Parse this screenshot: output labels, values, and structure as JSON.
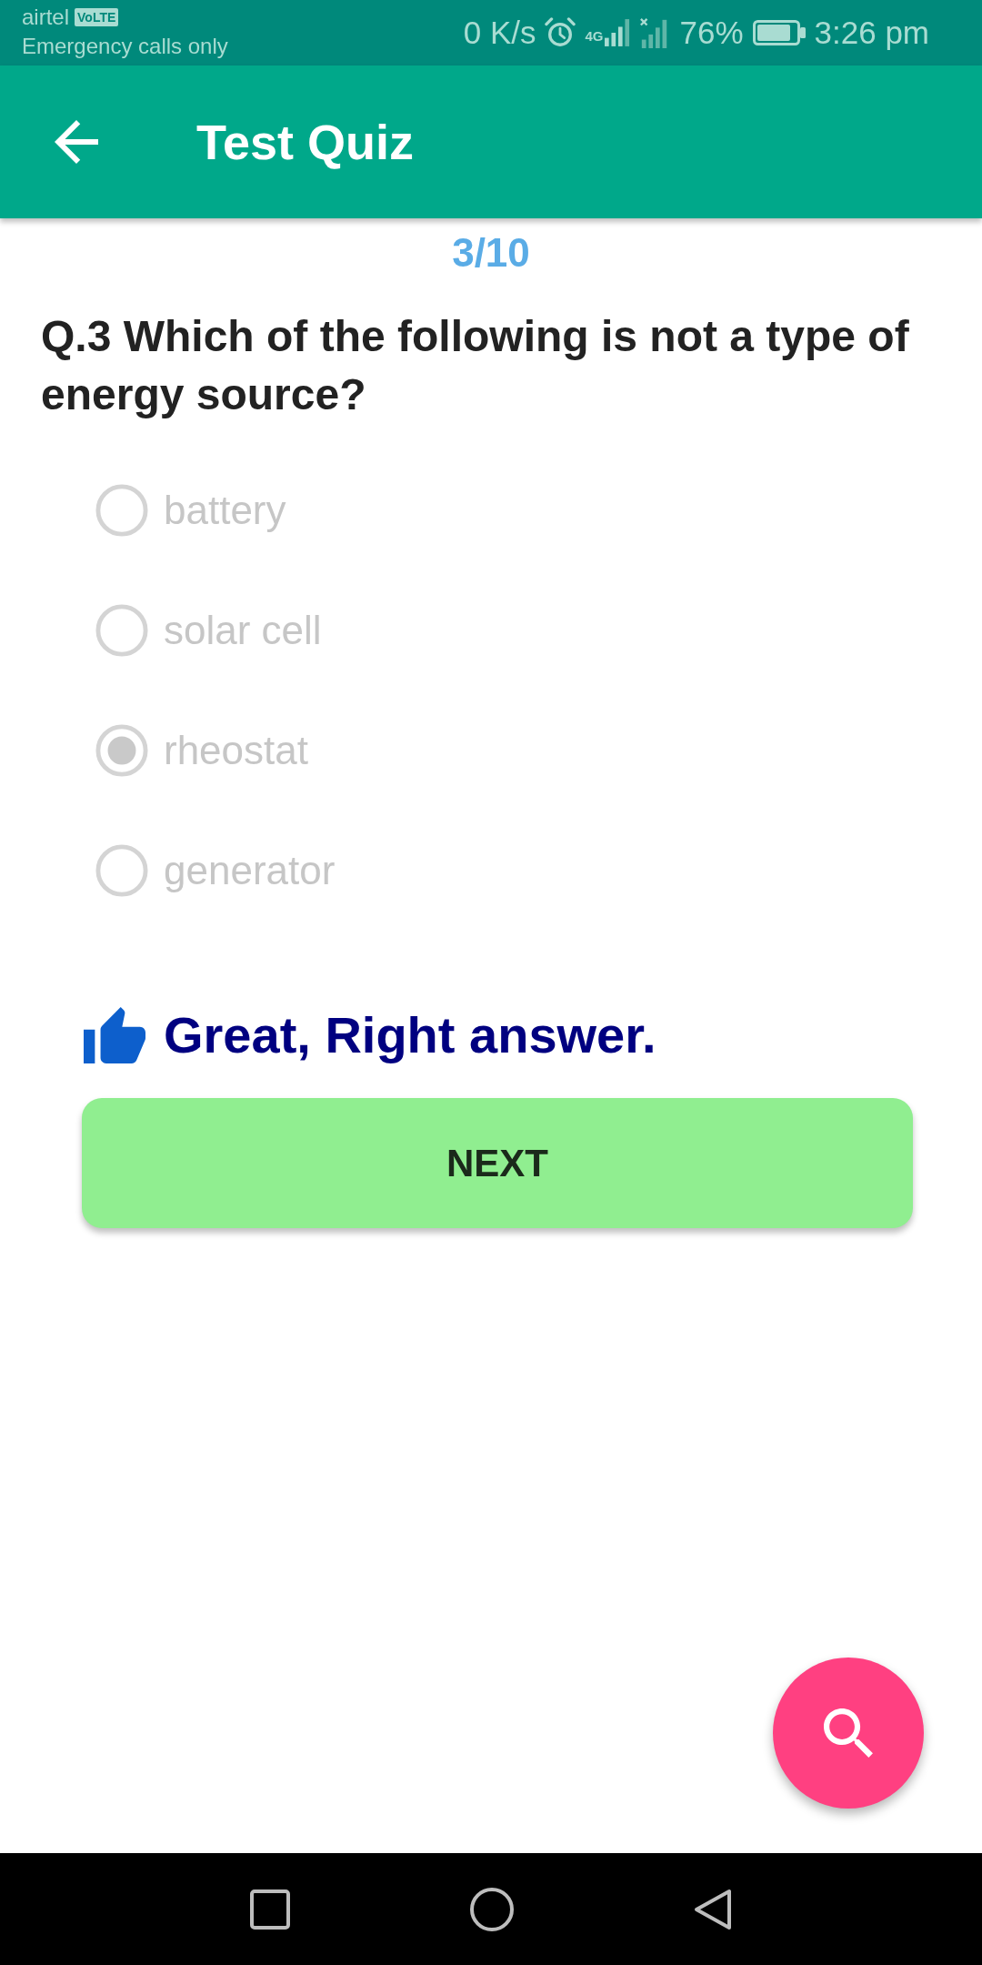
{
  "status_bar": {
    "carrier": "airtel",
    "carrier_badge": "VoLTE",
    "network_note": "Emergency calls only",
    "data_speed": "0 K/s",
    "network_type": "4G",
    "battery": "76%",
    "time": "3:26 pm"
  },
  "app_bar": {
    "title": "Test Quiz"
  },
  "quiz": {
    "progress": "3/10",
    "question": "Q.3 Which of the following is not a type of energy source?",
    "options": [
      {
        "label": "battery",
        "selected": false,
        "disabled": true
      },
      {
        "label": "solar cell",
        "selected": false,
        "disabled": true
      },
      {
        "label": "rheostat",
        "selected": true,
        "disabled": true
      },
      {
        "label": "generator",
        "selected": false,
        "disabled": true
      }
    ]
  },
  "feedback": {
    "correct": true,
    "message": "Great, Right answer."
  },
  "next_button": {
    "label": "NEXT"
  }
}
